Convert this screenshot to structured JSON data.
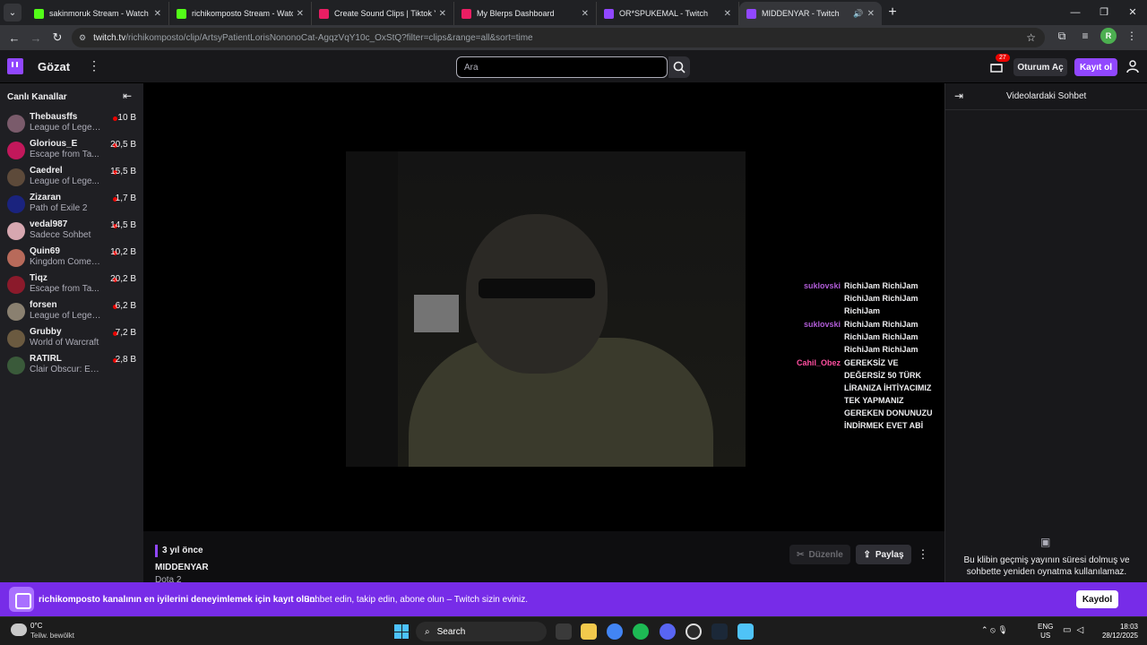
{
  "browser": {
    "tabs": [
      {
        "title": "sakinmoruk Stream - Watch Live",
        "favicon_color": "#53fc18",
        "active": false
      },
      {
        "title": "richikomposto Stream - Watch Live",
        "favicon_color": "#53fc18",
        "active": false
      },
      {
        "title": "Create Sound Clips | Tiktok Youtube",
        "favicon_color": "#e91e63",
        "active": false
      },
      {
        "title": "My Blerps Dashboard",
        "favicon_color": "#e91e63",
        "active": false
      },
      {
        "title": "OR*SPUKEMAL - Twitch",
        "favicon_color": "#9147ff",
        "active": false
      },
      {
        "title": "MIDDENYAR - Twitch",
        "favicon_color": "#9147ff",
        "active": true
      }
    ],
    "url_host": "twitch.tv",
    "url_path": "/richikomposto/clip/ArtsyPatientLorisNononoCat-AgqzVqY10c_OxStQ?filter=clips&range=all&sort=time",
    "profile_initial": "R"
  },
  "header": {
    "browse_label": "Gözat",
    "search_placeholder": "Ara",
    "notifications_count": "27",
    "login_label": "Oturum Aç",
    "signup_label": "Kayıt ol"
  },
  "sidebar": {
    "title": "Canlı Kanallar",
    "channels": [
      {
        "name": "Thebausffs",
        "game": "League of Legends",
        "viewers": "10 B",
        "avatar_color": "#7a5b6b"
      },
      {
        "name": "Glorious_E",
        "game": "Escape from Ta...",
        "viewers": "20,5 B",
        "avatar_color": "#c2185b"
      },
      {
        "name": "Caedrel",
        "game": "League of Lege...",
        "viewers": "15,5 B",
        "avatar_color": "#5d4a3a"
      },
      {
        "name": "Zizaran",
        "game": "Path of Exile 2",
        "viewers": "1,7 B",
        "avatar_color": "#1a237e"
      },
      {
        "name": "vedal987",
        "game": "Sadece Sohbet",
        "viewers": "14,5 B",
        "avatar_color": "#d7a7b0"
      },
      {
        "name": "Quin69",
        "game": "Kingdom Come:...",
        "viewers": "10,2 B",
        "avatar_color": "#b86a5a"
      },
      {
        "name": "Tiqz",
        "game": "Escape from Ta...",
        "viewers": "20,2 B",
        "avatar_color": "#8b1a2b"
      },
      {
        "name": "forsen",
        "game": "League of Legen...",
        "viewers": "6,2 B",
        "avatar_color": "#8a8070"
      },
      {
        "name": "Grubby",
        "game": "World of Warcraft",
        "viewers": "7,2 B",
        "avatar_color": "#6b5a40"
      },
      {
        "name": "RATIRL",
        "game": "Clair Obscur: Ex...",
        "viewers": "2,8 B",
        "avatar_color": "#3a5a3a"
      }
    ]
  },
  "overlay_chat": [
    {
      "user": "suklovski",
      "color": "#b05cd6",
      "message": "RichiJam RichiJam RichiJam RichiJam RichiJam"
    },
    {
      "user": "suklovski",
      "color": "#b05cd6",
      "message": "RichiJam RichiJam RichiJam RichiJam RichiJam RichiJam"
    },
    {
      "user": "Cahil_Obez",
      "color": "#ff4fa0",
      "message": "GEREKSİZ VE DEĞERSİZ 50 TÜRK LİRANIZA İHTİYACIMIZ TEK YAPMANIZ GEREKEN DONUNUZU İNDİRMEK EVET ABİ"
    }
  ],
  "clip": {
    "date": "3 yıl önce",
    "channel": "MIDDENYAR",
    "game": "Dota 2",
    "edit_label": "Düzenle",
    "share_label": "Paylaş"
  },
  "chat_panel": {
    "title": "Videolardaki Sohbet",
    "empty_message": "Bu klibin geçmiş yayının süresi dolmuş ve sohbette yeniden oynatma kullanılamaz."
  },
  "banner": {
    "strong_text": "richikomposto kanalının en iyilerini deneyimlemek için kayıt olun.",
    "sub_text": "Sohbet edin, takip edin, abone olun – Twitch sizin eviniz.",
    "button_label": "Kaydol"
  },
  "taskbar": {
    "temperature": "0°C",
    "weather_desc": "Teilw. bewölkt",
    "search_label": "Search",
    "lang_line1": "ENG",
    "lang_line2": "US",
    "time": "18:03",
    "date": "28/12/2025"
  },
  "colors": {
    "twitch_purple": "#9147ff",
    "banner_purple": "#772ce8",
    "live_red": "#eb0400"
  }
}
